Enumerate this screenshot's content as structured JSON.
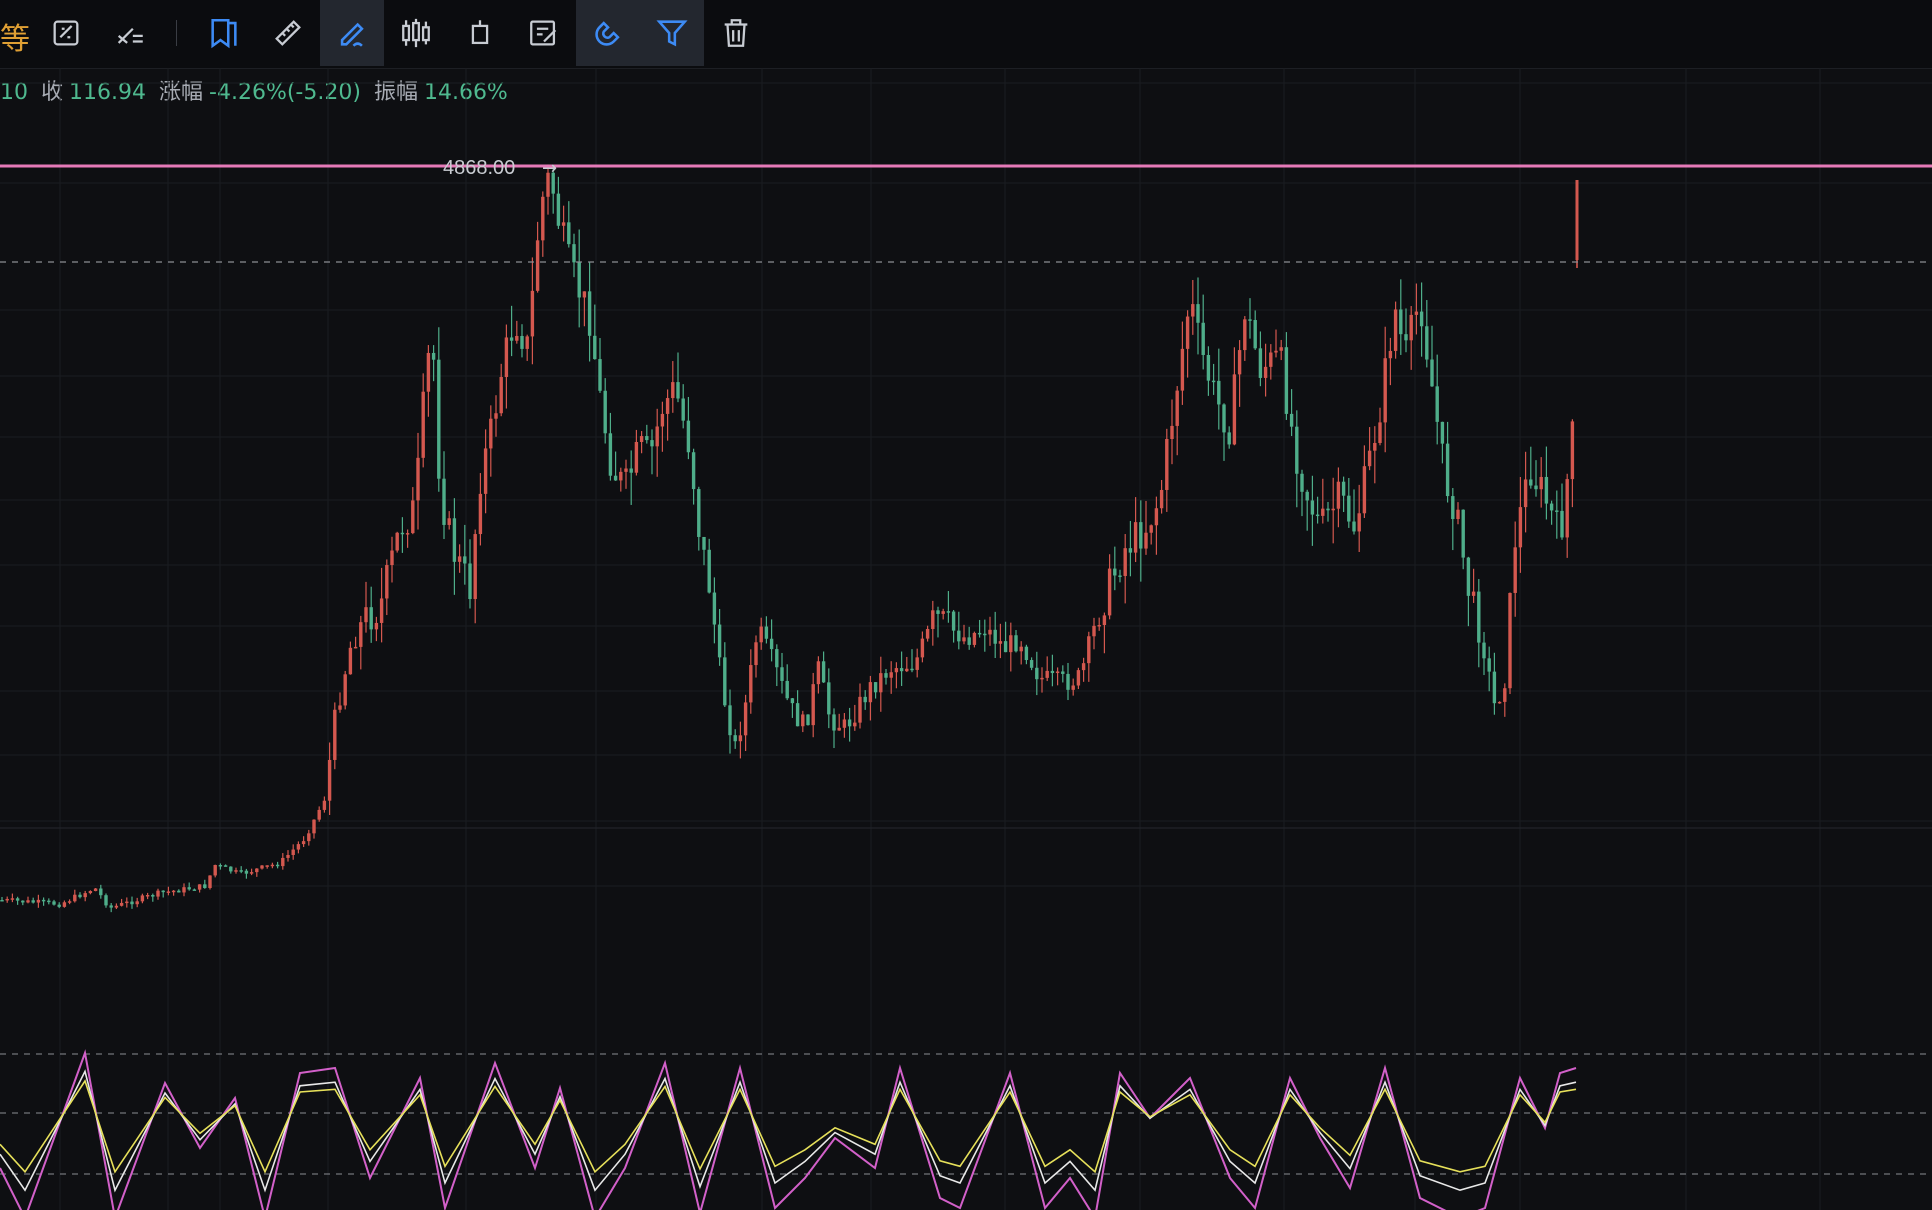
{
  "toolbar": {
    "truncated_label": "等",
    "tools": [
      {
        "name": "sync-drawing-icon",
        "active": false
      },
      {
        "name": "line-settings-icon",
        "active": false
      },
      {
        "name": "bookmark-icon",
        "active": false
      },
      {
        "name": "ruler-icon",
        "active": false
      },
      {
        "name": "draw-pen-icon",
        "active": true
      },
      {
        "name": "candles-icon",
        "active": false
      },
      {
        "name": "single-candle-icon",
        "active": false
      },
      {
        "name": "note-edit-icon",
        "active": false
      },
      {
        "name": "magnet-icon",
        "active": true
      },
      {
        "name": "filter-icon",
        "active": true
      },
      {
        "name": "trash-icon",
        "active": false
      }
    ]
  },
  "info_bar": {
    "prev_value": "10",
    "close_label": "收",
    "close_value": "116.94",
    "change_label": "涨幅",
    "change_value": "-4.26%(-5.20)",
    "amplitude_label": "振幅",
    "amplitude_value": "14.66%"
  },
  "price_line": {
    "label": "4868.00",
    "arrow": "→"
  },
  "colors": {
    "up": "#d4584f",
    "down": "#4fae8a",
    "price_line": "#e57ab8",
    "k_line": "#d260c9",
    "d_line": "#e8e8e8",
    "j_line": "#e6e05a",
    "accent": "#3d8bf5"
  },
  "chart_data": {
    "type": "candlestick",
    "title": "",
    "horizontal_line": 4868.0,
    "approx_y_range": [
      0,
      4900
    ],
    "indicator": {
      "type": "oscillator",
      "lines": 3,
      "range": [
        0,
        100
      ]
    }
  }
}
